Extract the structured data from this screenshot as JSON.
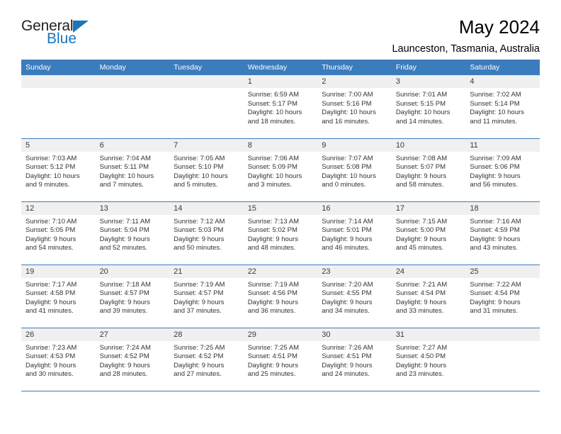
{
  "logo": {
    "word1": "General",
    "word2": "Blue",
    "triangle_color": "#1b75bb",
    "text_color": "#231f20"
  },
  "header": {
    "title": "May 2024",
    "subtitle": "Launceston, Tasmania, Australia"
  },
  "theme": {
    "header_bg": "#3b7cbd",
    "header_text": "#ffffff",
    "daynum_bg": "#f0f0f0",
    "row_divider": "#3b7cbd"
  },
  "weekday_headers": [
    "Sunday",
    "Monday",
    "Tuesday",
    "Wednesday",
    "Thursday",
    "Friday",
    "Saturday"
  ],
  "weeks": [
    [
      {
        "day": "",
        "lines": []
      },
      {
        "day": "",
        "lines": []
      },
      {
        "day": "",
        "lines": []
      },
      {
        "day": "1",
        "lines": [
          "Sunrise: 6:59 AM",
          "Sunset: 5:17 PM",
          "Daylight: 10 hours",
          "and 18 minutes."
        ]
      },
      {
        "day": "2",
        "lines": [
          "Sunrise: 7:00 AM",
          "Sunset: 5:16 PM",
          "Daylight: 10 hours",
          "and 16 minutes."
        ]
      },
      {
        "day": "3",
        "lines": [
          "Sunrise: 7:01 AM",
          "Sunset: 5:15 PM",
          "Daylight: 10 hours",
          "and 14 minutes."
        ]
      },
      {
        "day": "4",
        "lines": [
          "Sunrise: 7:02 AM",
          "Sunset: 5:14 PM",
          "Daylight: 10 hours",
          "and 11 minutes."
        ]
      }
    ],
    [
      {
        "day": "5",
        "lines": [
          "Sunrise: 7:03 AM",
          "Sunset: 5:12 PM",
          "Daylight: 10 hours",
          "and 9 minutes."
        ]
      },
      {
        "day": "6",
        "lines": [
          "Sunrise: 7:04 AM",
          "Sunset: 5:11 PM",
          "Daylight: 10 hours",
          "and 7 minutes."
        ]
      },
      {
        "day": "7",
        "lines": [
          "Sunrise: 7:05 AM",
          "Sunset: 5:10 PM",
          "Daylight: 10 hours",
          "and 5 minutes."
        ]
      },
      {
        "day": "8",
        "lines": [
          "Sunrise: 7:06 AM",
          "Sunset: 5:09 PM",
          "Daylight: 10 hours",
          "and 3 minutes."
        ]
      },
      {
        "day": "9",
        "lines": [
          "Sunrise: 7:07 AM",
          "Sunset: 5:08 PM",
          "Daylight: 10 hours",
          "and 0 minutes."
        ]
      },
      {
        "day": "10",
        "lines": [
          "Sunrise: 7:08 AM",
          "Sunset: 5:07 PM",
          "Daylight: 9 hours",
          "and 58 minutes."
        ]
      },
      {
        "day": "11",
        "lines": [
          "Sunrise: 7:09 AM",
          "Sunset: 5:06 PM",
          "Daylight: 9 hours",
          "and 56 minutes."
        ]
      }
    ],
    [
      {
        "day": "12",
        "lines": [
          "Sunrise: 7:10 AM",
          "Sunset: 5:05 PM",
          "Daylight: 9 hours",
          "and 54 minutes."
        ]
      },
      {
        "day": "13",
        "lines": [
          "Sunrise: 7:11 AM",
          "Sunset: 5:04 PM",
          "Daylight: 9 hours",
          "and 52 minutes."
        ]
      },
      {
        "day": "14",
        "lines": [
          "Sunrise: 7:12 AM",
          "Sunset: 5:03 PM",
          "Daylight: 9 hours",
          "and 50 minutes."
        ]
      },
      {
        "day": "15",
        "lines": [
          "Sunrise: 7:13 AM",
          "Sunset: 5:02 PM",
          "Daylight: 9 hours",
          "and 48 minutes."
        ]
      },
      {
        "day": "16",
        "lines": [
          "Sunrise: 7:14 AM",
          "Sunset: 5:01 PM",
          "Daylight: 9 hours",
          "and 46 minutes."
        ]
      },
      {
        "day": "17",
        "lines": [
          "Sunrise: 7:15 AM",
          "Sunset: 5:00 PM",
          "Daylight: 9 hours",
          "and 45 minutes."
        ]
      },
      {
        "day": "18",
        "lines": [
          "Sunrise: 7:16 AM",
          "Sunset: 4:59 PM",
          "Daylight: 9 hours",
          "and 43 minutes."
        ]
      }
    ],
    [
      {
        "day": "19",
        "lines": [
          "Sunrise: 7:17 AM",
          "Sunset: 4:58 PM",
          "Daylight: 9 hours",
          "and 41 minutes."
        ]
      },
      {
        "day": "20",
        "lines": [
          "Sunrise: 7:18 AM",
          "Sunset: 4:57 PM",
          "Daylight: 9 hours",
          "and 39 minutes."
        ]
      },
      {
        "day": "21",
        "lines": [
          "Sunrise: 7:19 AM",
          "Sunset: 4:57 PM",
          "Daylight: 9 hours",
          "and 37 minutes."
        ]
      },
      {
        "day": "22",
        "lines": [
          "Sunrise: 7:19 AM",
          "Sunset: 4:56 PM",
          "Daylight: 9 hours",
          "and 36 minutes."
        ]
      },
      {
        "day": "23",
        "lines": [
          "Sunrise: 7:20 AM",
          "Sunset: 4:55 PM",
          "Daylight: 9 hours",
          "and 34 minutes."
        ]
      },
      {
        "day": "24",
        "lines": [
          "Sunrise: 7:21 AM",
          "Sunset: 4:54 PM",
          "Daylight: 9 hours",
          "and 33 minutes."
        ]
      },
      {
        "day": "25",
        "lines": [
          "Sunrise: 7:22 AM",
          "Sunset: 4:54 PM",
          "Daylight: 9 hours",
          "and 31 minutes."
        ]
      }
    ],
    [
      {
        "day": "26",
        "lines": [
          "Sunrise: 7:23 AM",
          "Sunset: 4:53 PM",
          "Daylight: 9 hours",
          "and 30 minutes."
        ]
      },
      {
        "day": "27",
        "lines": [
          "Sunrise: 7:24 AM",
          "Sunset: 4:52 PM",
          "Daylight: 9 hours",
          "and 28 minutes."
        ]
      },
      {
        "day": "28",
        "lines": [
          "Sunrise: 7:25 AM",
          "Sunset: 4:52 PM",
          "Daylight: 9 hours",
          "and 27 minutes."
        ]
      },
      {
        "day": "29",
        "lines": [
          "Sunrise: 7:25 AM",
          "Sunset: 4:51 PM",
          "Daylight: 9 hours",
          "and 25 minutes."
        ]
      },
      {
        "day": "30",
        "lines": [
          "Sunrise: 7:26 AM",
          "Sunset: 4:51 PM",
          "Daylight: 9 hours",
          "and 24 minutes."
        ]
      },
      {
        "day": "31",
        "lines": [
          "Sunrise: 7:27 AM",
          "Sunset: 4:50 PM",
          "Daylight: 9 hours",
          "and 23 minutes."
        ]
      },
      {
        "day": "",
        "lines": []
      }
    ]
  ]
}
